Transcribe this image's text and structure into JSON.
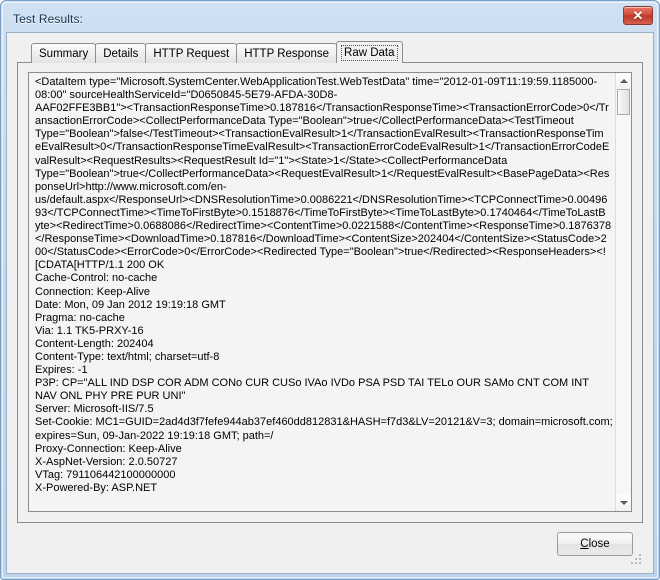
{
  "window": {
    "title": "Test Results:",
    "close_icon": "close-icon",
    "close_glyph": "✕"
  },
  "tabs": [
    {
      "label": "Summary",
      "active": false
    },
    {
      "label": "Details",
      "active": false
    },
    {
      "label": "HTTP Request",
      "active": false
    },
    {
      "label": "HTTP Response",
      "active": false
    },
    {
      "label": "Raw Data",
      "active": true
    }
  ],
  "raw_data": {
    "lines": [
      "<DataItem type=\"Microsoft.SystemCenter.WebApplicationTest.WebTestData\" time=\"2012-01-09T11:19:59.1185000-",
      "08:00\" sourceHealthServiceId=\"D0650845-5E79-AFDA-30D8-",
      "AAF02FFE3BB1\"><TransactionResponseTime>0.187816</TransactionResponseTime><TransactionErrorCode>0</Tr",
      "ansactionErrorCode><CollectPerformanceData Type=\"Boolean\">true</CollectPerformanceData><TestTimeout",
      "Type=\"Boolean\">false</TestTimeout><TransactionEvalResult>1</TransactionEvalResult><TransactionResponseTim",
      "eEvalResult>0</TransactionResponseTimeEvalResult><TransactionErrorCodeEvalResult>1</TransactionErrorCodeE",
      "valResult><RequestResults><RequestResult Id=\"1\"><State>1</State><CollectPerformanceData",
      "Type=\"Boolean\">true</CollectPerformanceData><RequestEvalResult>1</RequestEvalResult><BasePageData><Res",
      "ponseUrl>http://www.microsoft.com/en-",
      "us/default.aspx</ResponseUrl><DNSResolutionTime>0.0086221</DNSResolutionTime><TCPConnectTime>0.00496",
      "93</TCPConnectTime><TimeToFirstByte>0.1518876</TimeToFirstByte><TimeToLastByte>0.1740464</TimeToLastB",
      "yte><RedirectTime>0.0688086</RedirectTime><ContentTime>0.0221588</ContentTime><ResponseTime>0.1876378",
      "</ResponseTime><DownloadTime>0.187816</DownloadTime><ContentSize>202404</ContentSize><StatusCode>2",
      "00</StatusCode><ErrorCode>0</ErrorCode><Redirected Type=\"Boolean\">true</Redirected><ResponseHeaders><!",
      "[CDATA[HTTP/1.1 200 OK",
      "Cache-Control: no-cache",
      "Connection: Keep-Alive",
      "Date: Mon, 09 Jan 2012 19:19:18 GMT",
      "Pragma: no-cache",
      "Via: 1.1 TK5-PRXY-16",
      "Content-Length: 202404",
      "Content-Type: text/html; charset=utf-8",
      "Expires: -1",
      "P3P: CP=\"ALL IND DSP COR ADM CONo CUR CUSo IVAo IVDo PSA PSD TAI TELo OUR SAMo CNT COM INT",
      "NAV ONL PHY PRE PUR UNI\"",
      "Server: Microsoft-IIS/7.5",
      "Set-Cookie: MC1=GUID=2ad4d3f7fefe944ab37ef460dd812831&HASH=f7d3&LV=20121&V=3; domain=microsoft.com;",
      "expires=Sun, 09-Jan-2022 19:19:18 GMT; path=/",
      "Proxy-Connection: Keep-Alive",
      "X-AspNet-Version: 2.0.50727",
      "VTag: 791106442100000000",
      "X-Powered-By: ASP.NET"
    ]
  },
  "scrollbar": {
    "up_icon": "scroll-up-arrow-icon",
    "down_icon": "scroll-down-arrow-icon",
    "thumb_name": "scrollbar-thumb"
  },
  "footer": {
    "close_button_accel": "C",
    "close_button_rest": "lose"
  },
  "colors": {
    "frame": "#bdd4ec",
    "client": "#f0f0f0",
    "textbox": "#f4f4f4",
    "close_red": "#d34c3c"
  }
}
